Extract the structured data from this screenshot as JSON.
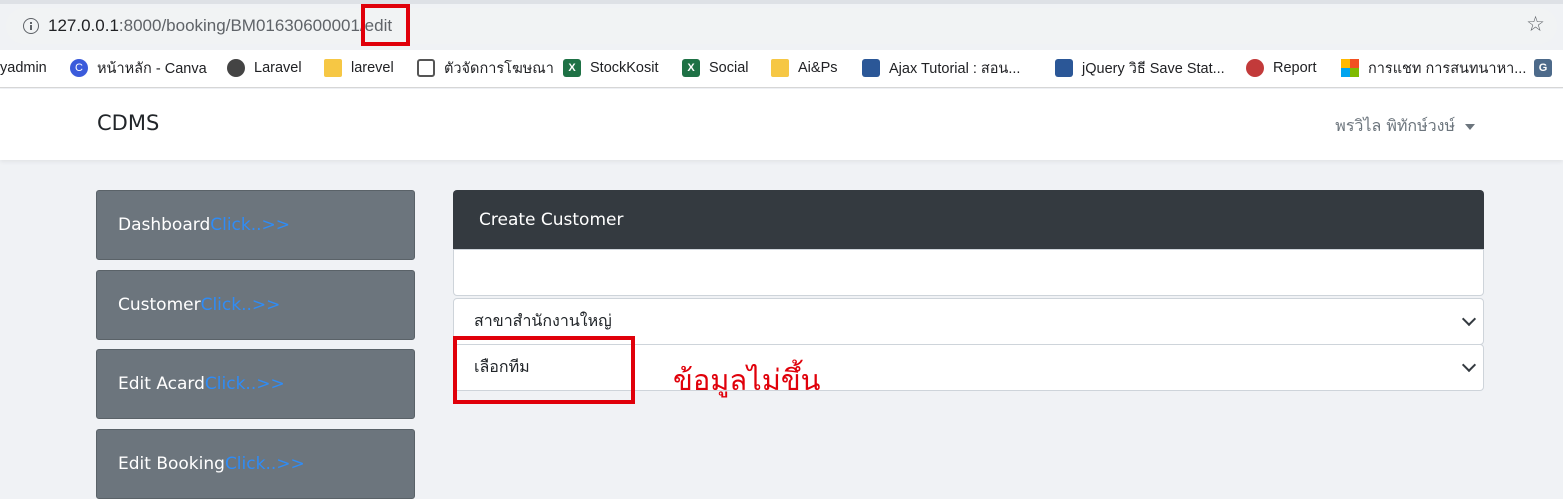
{
  "browser": {
    "url_host": "127.0.0.1",
    "url_rest": ":8000/booking/BM01630600001/edit",
    "bookmarks": [
      {
        "label": "yadmin",
        "icon": "none"
      },
      {
        "label": "หน้าหลัก - Canva",
        "icon": "canva-icon"
      },
      {
        "label": "Laravel",
        "icon": "globe-icon"
      },
      {
        "label": "larevel",
        "icon": "folder-icon"
      },
      {
        "label": "ตัวจัดการโฆษณา",
        "icon": "page-icon"
      },
      {
        "label": "StockKosit",
        "icon": "excel-icon"
      },
      {
        "label": "Social",
        "icon": "excel-icon"
      },
      {
        "label": "Ai&Ps",
        "icon": "folder-icon"
      },
      {
        "label": "Ajax Tutorial : สอน...",
        "icon": "doc-icon"
      },
      {
        "label": "jQuery วิธี Save Stat...",
        "icon": "doc-icon"
      },
      {
        "label": "Report",
        "icon": "flower-icon"
      },
      {
        "label": "การแชท การสนทนาหา...",
        "icon": "microsoft-icon"
      }
    ]
  },
  "navbar": {
    "brand": "CDMS",
    "user_name": "พรวิไล พิทักษ์วงษ์"
  },
  "sidebar": {
    "items": [
      {
        "label": "Dashboard ",
        "click": "Click..>>"
      },
      {
        "label": "Customer ",
        "click": "Click..>>"
      },
      {
        "label": "Edit Acard",
        "click": "Click..>>"
      },
      {
        "label": "Edit Booking ",
        "click": "Click..>>"
      }
    ]
  },
  "card": {
    "title": "Create Customer",
    "branch_select": "สาขาสำนักงานใหญ่",
    "team_select": "เลือกทีม"
  },
  "annotation": {
    "text": "ข้อมูลไม่ขึ้น",
    "color": "#e0000a"
  }
}
